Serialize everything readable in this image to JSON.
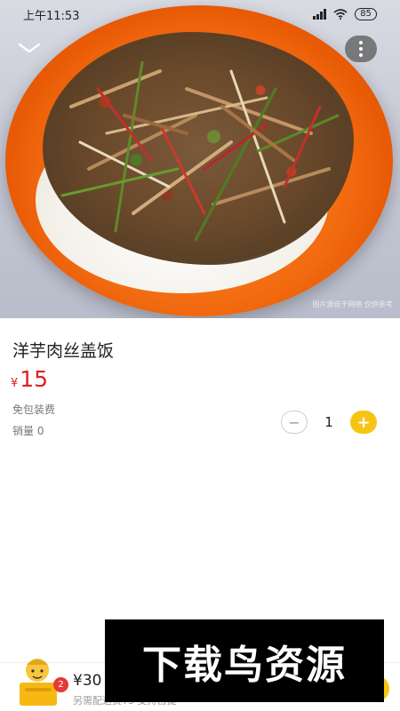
{
  "status_bar": {
    "time": "上午11:53",
    "battery": "85",
    "icons": [
      "hd-signal-icon",
      "wifi-icon",
      "battery-icon"
    ]
  },
  "hero": {
    "collapse_icon": "chevron-down-icon",
    "more_icon": "more-vertical-icon",
    "image_caption": "图片源自于网络 仅供参考"
  },
  "product": {
    "name": "洋芋肉丝盖饭",
    "currency": "¥",
    "price": "15",
    "packaging": "免包装费",
    "sales": "销量 0"
  },
  "quantity": {
    "minus_label": "−",
    "value": "1",
    "plus_label": "+"
  },
  "cart": {
    "badge_count": "2",
    "total": "¥30",
    "delivery_note": "另需配送费¥3 支持自提"
  },
  "watermark": {
    "text": "下载鸟资源"
  },
  "colors": {
    "price": "#e02020",
    "accent": "#f6c513",
    "badge": "#e53935"
  }
}
